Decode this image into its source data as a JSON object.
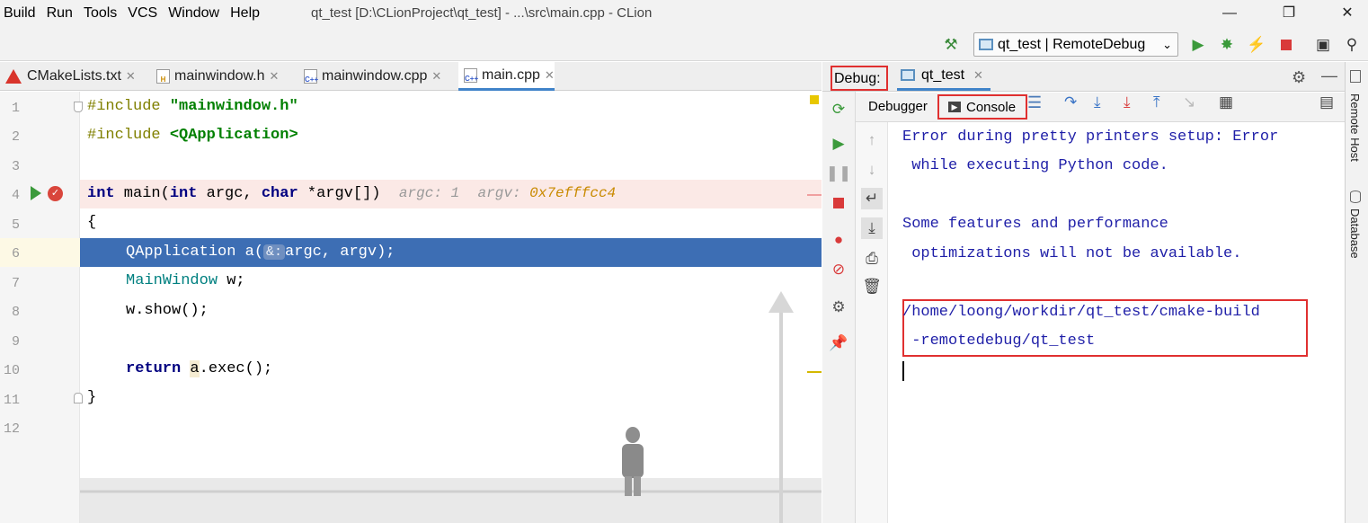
{
  "menubar": {
    "items": [
      "Build",
      "Run",
      "Tools",
      "VCS",
      "Window",
      "Help"
    ],
    "window_title": "qt_test [D:\\CLionProject\\qt_test] - ...\\src\\main.cpp - CLion"
  },
  "toolbar": {
    "run_config": "qt_test | RemoteDebug"
  },
  "editor_tabs": [
    {
      "label": "CMakeLists.txt",
      "icon": "cmake-icon"
    },
    {
      "label": "mainwindow.h",
      "icon": "header-file-icon"
    },
    {
      "label": "mainwindow.cpp",
      "icon": "cpp-file-icon"
    },
    {
      "label": "main.cpp",
      "icon": "cpp-file-icon",
      "active": true
    }
  ],
  "editor": {
    "line_numbers": [
      "1",
      "2",
      "3",
      "4",
      "5",
      "6",
      "7",
      "8",
      "9",
      "10",
      "11",
      "12"
    ],
    "line1": {
      "directive": "#include",
      "file": "\"mainwindow.h\""
    },
    "line2": {
      "directive": "#include",
      "file": "<QApplication>"
    },
    "line4": {
      "kw1": "int",
      "fn": " main(",
      "kw2": "int",
      "p1": " argc, ",
      "kw3": "char",
      "p2": " *argv[])",
      "hint1": "argc: 1",
      "hint2": "argv: ",
      "hint2val": "0x7efffcc4"
    },
    "line5": "{",
    "line6": {
      "pre": "QApplication a(",
      "amp": "&:",
      "post": "argc, argv);"
    },
    "line7": {
      "type": "MainWindow",
      "rest": " w;"
    },
    "line8": "w.show();",
    "line10": {
      "kw": "return",
      "obj": "a",
      "rest": ".exec();"
    },
    "line11": "}"
  },
  "debug": {
    "label": "Debug:",
    "session_tab": "qt_test",
    "sub_tabs": {
      "debugger": "Debugger",
      "console": "Console"
    },
    "console_lines": [
      "Error during pretty printers setup: Error",
      " while executing Python code.",
      "",
      "Some features and performance",
      " optimizations will not be available.",
      "",
      "/home/loong/workdir/qt_test/cmake-build",
      " -remotedebug/qt_test"
    ]
  },
  "right_strip": {
    "items": [
      "Remote Host",
      "Database"
    ]
  },
  "colors": {
    "accent": "#4083c9",
    "execution_line": "#3d6eb4",
    "breakpoint_line": "#fbe9e6",
    "highlight_box": "#e03030"
  }
}
